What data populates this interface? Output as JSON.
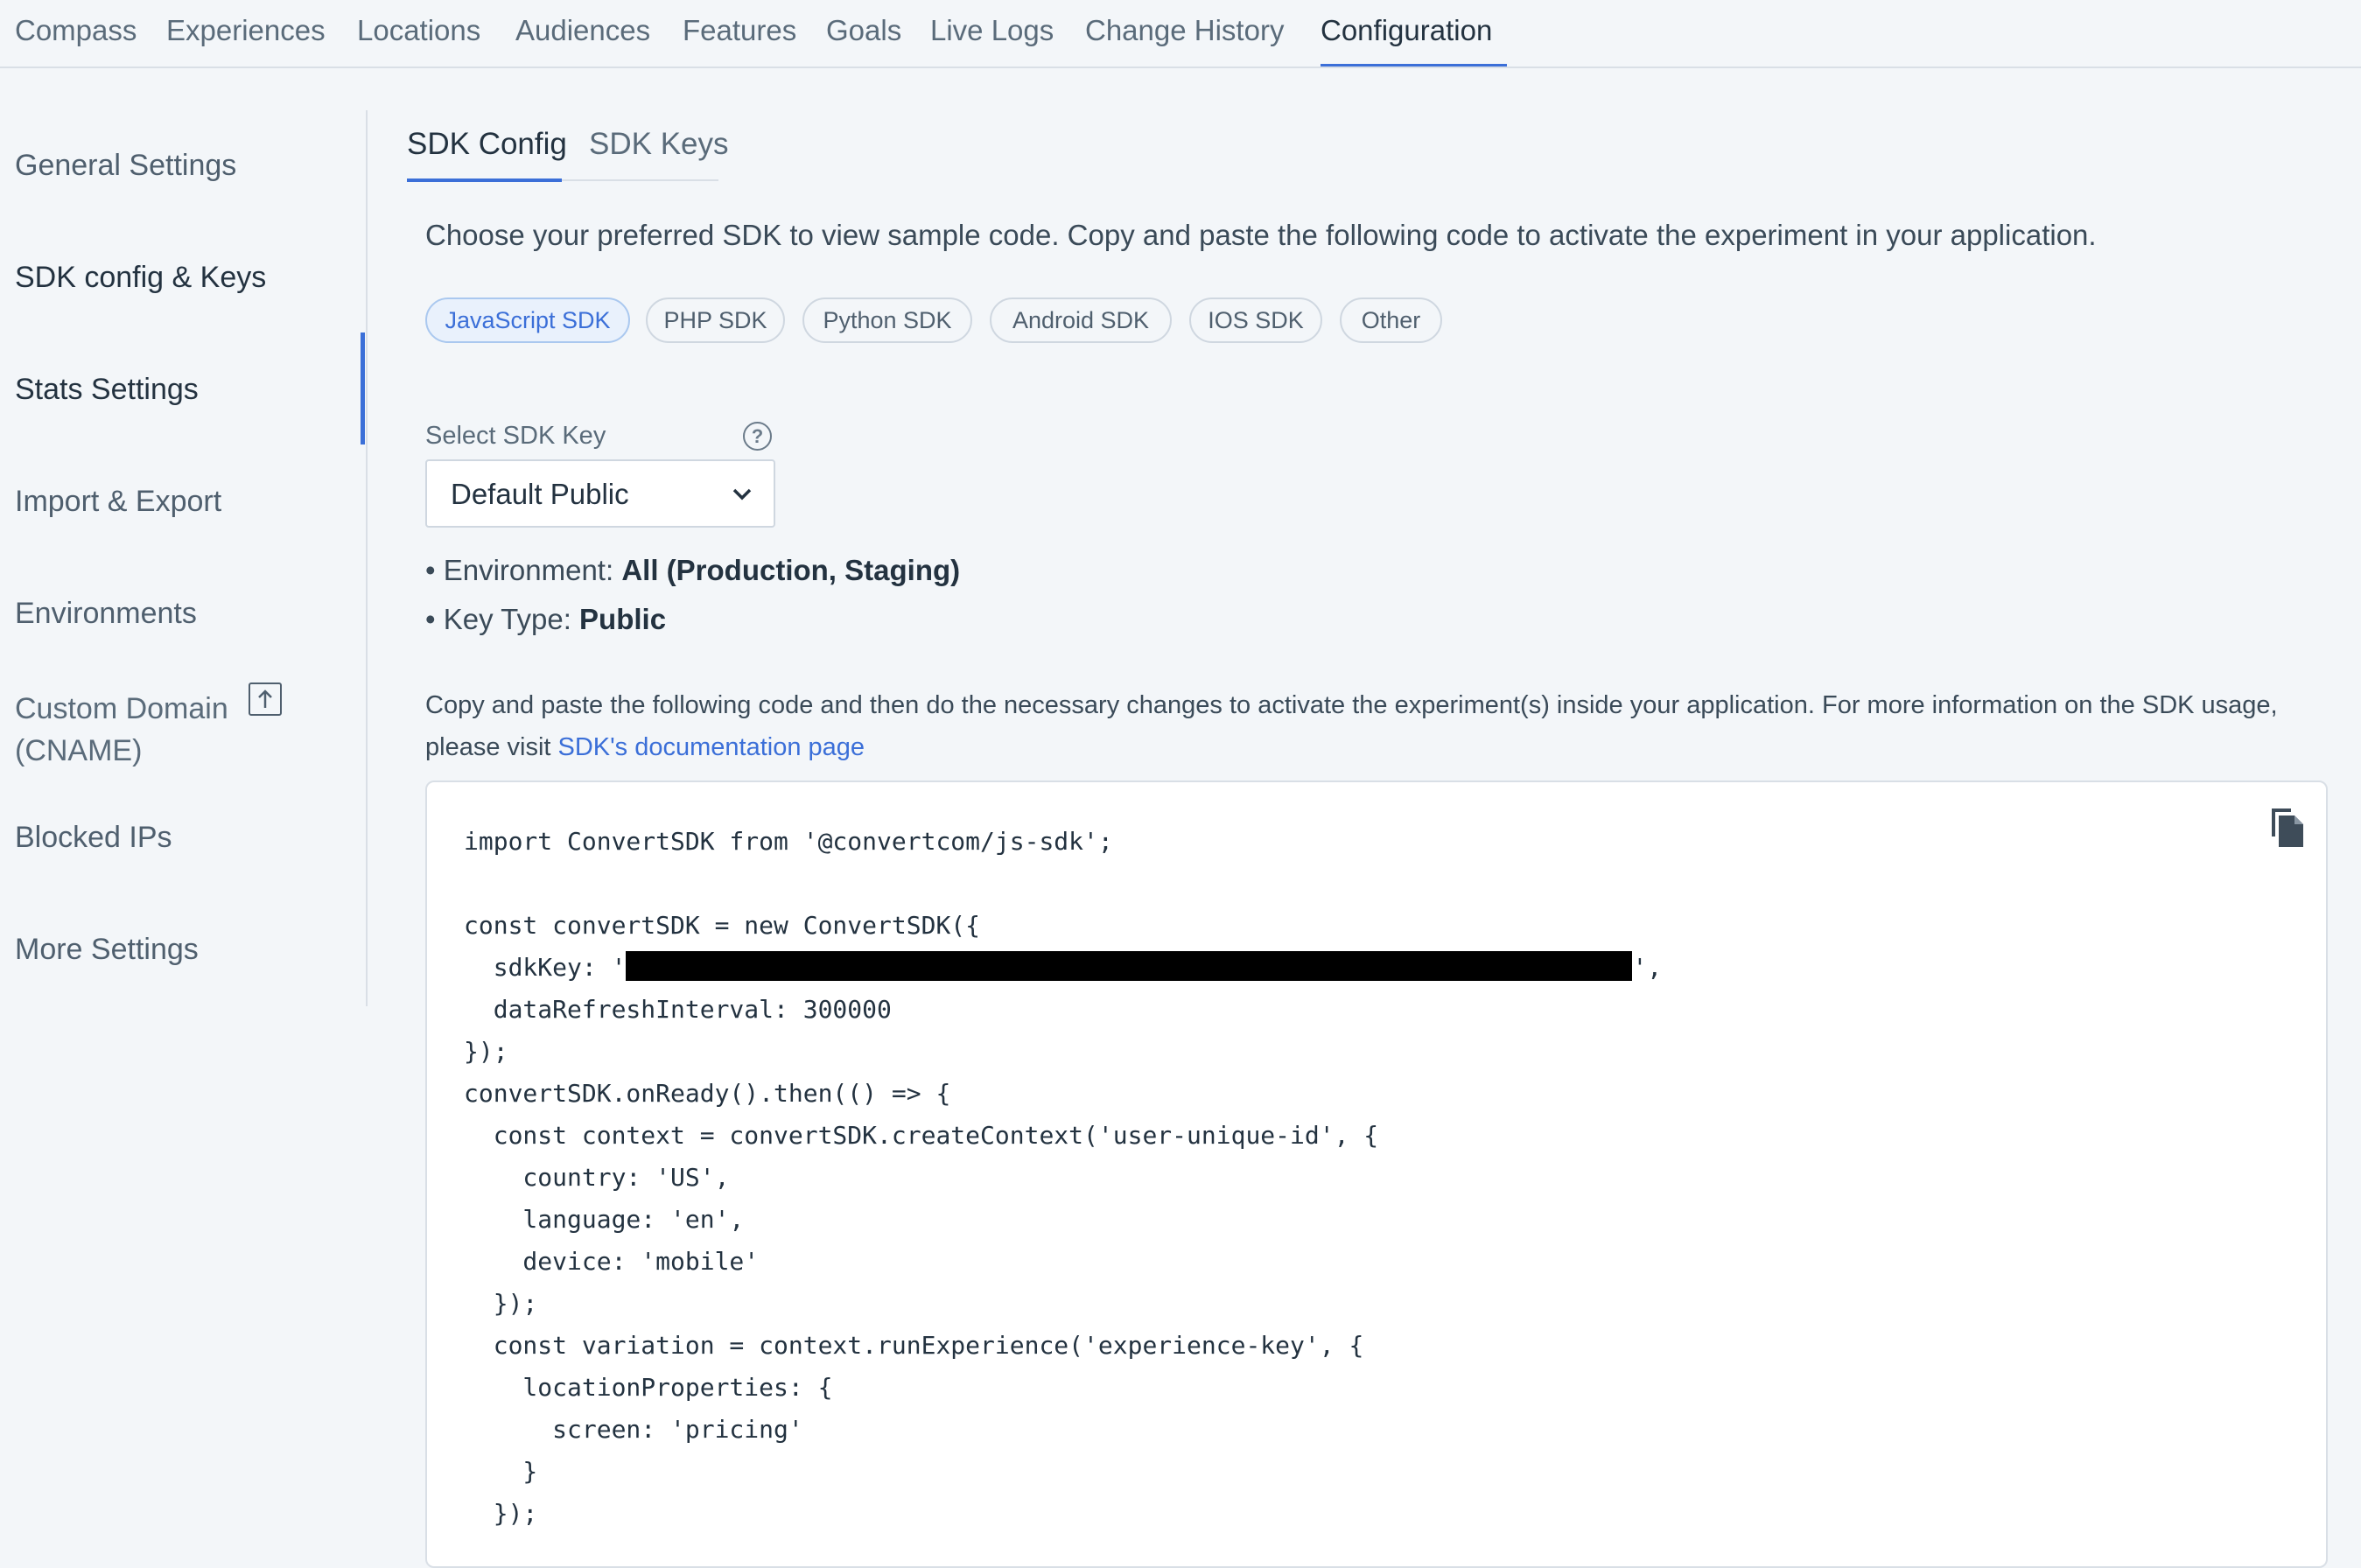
{
  "top_nav": {
    "tabs": [
      {
        "label": "Compass"
      },
      {
        "label": "Experiences"
      },
      {
        "label": "Locations"
      },
      {
        "label": "Audiences"
      },
      {
        "label": "Features"
      },
      {
        "label": "Goals"
      },
      {
        "label": "Live Logs"
      },
      {
        "label": "Change History"
      },
      {
        "label": "Configuration",
        "active": true
      }
    ]
  },
  "sidebar": {
    "items": [
      {
        "label": "General Settings"
      },
      {
        "label": "SDK config & Keys",
        "active": true
      },
      {
        "label": "Stats Settings"
      },
      {
        "label": "Import & Export"
      },
      {
        "label": "Environments"
      },
      {
        "label": "Custom Domain",
        "label_line2": "(CNAME)",
        "icon": "external-upload-icon"
      },
      {
        "label": "Blocked IPs"
      },
      {
        "label": "More Settings"
      }
    ]
  },
  "sub_tabs": [
    {
      "label": "SDK Config",
      "active": true
    },
    {
      "label": "SDK Keys"
    }
  ],
  "intro_text": "Choose your preferred SDK to view sample code. Copy and paste the following code to activate the experiment in your application.",
  "sdk_chips": [
    {
      "label": "JavaScript SDK",
      "active": true
    },
    {
      "label": "PHP SDK"
    },
    {
      "label": "Python SDK"
    },
    {
      "label": "Android SDK"
    },
    {
      "label": "IOS SDK"
    },
    {
      "label": "Other"
    }
  ],
  "sdk_key_select": {
    "label": "Select SDK Key",
    "value": "Default Public",
    "help_icon": "question-circle-icon"
  },
  "key_info": {
    "environment_label": "• Environment: ",
    "environment_value": "All (Production, Staging)",
    "key_type_label": "• Key Type: ",
    "key_type_value": "Public"
  },
  "description": {
    "text": "Copy and paste the following code and then do the necessary changes to activate the experiment(s) inside your application. For more information on the SDK usage, please visit ",
    "link_text": "SDK's documentation page"
  },
  "code": {
    "line1": "import ConvertSDK from '@convertcom/js-sdk';",
    "line2": "",
    "line3": "const convertSDK = new ConvertSDK({",
    "line4_prefix": "  sdkKey: '",
    "line4_suffix": "',",
    "line5": "  dataRefreshInterval: 300000",
    "line6": "});",
    "line7": "convertSDK.onReady().then(() => {",
    "line8": "  const context = convertSDK.createContext('user-unique-id', {",
    "line9": "    country: 'US',",
    "line10": "    language: 'en',",
    "line11": "    device: 'mobile'",
    "line12": "  });",
    "line13": "  const variation = context.runExperience('experience-key', {",
    "line14": "    locationProperties: {",
    "line15": "      screen: 'pricing'",
    "line16": "    }",
    "line17": "  });",
    "copy_icon": "copy-icon"
  }
}
